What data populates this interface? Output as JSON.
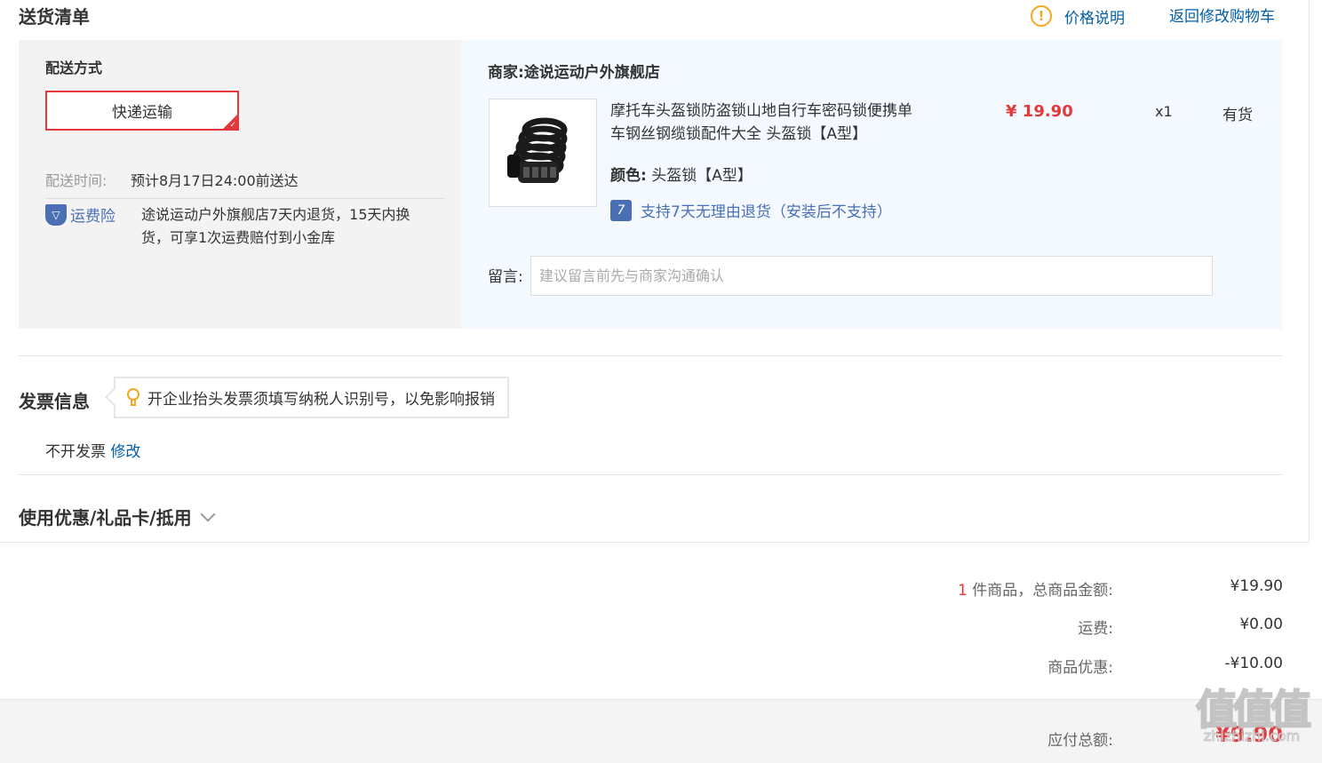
{
  "header": {
    "title": "送货清单",
    "price_note": "价格说明",
    "back_to_cart": "返回修改购物车"
  },
  "shipping": {
    "method_label": "配送方式",
    "method_selected": "快递运输",
    "time_label": "配送时间:",
    "time_value": "预计8月17日24:00前送达",
    "insurance_label": "运费险",
    "insurance_text_line1": "途说运动户外旗舰店7天内退货，15天内换",
    "insurance_text_line2": "货，可享1次运费赔付到小金库"
  },
  "store": {
    "label": "商家:",
    "name": "途说运动户外旗舰店",
    "product": {
      "title_line1": "摩托车头盔锁防盗锁山地自行车密码锁便携单",
      "title_line2": "车钢丝钢缆锁配件大全 头盔锁【A型】",
      "price": "¥ 19.90",
      "qty": "x1",
      "stock": "有货",
      "color_label": "颜色:",
      "color_value": "头盔锁【A型】",
      "return_badge": "7",
      "return_text": "支持7天无理由退货（安装后不支持）"
    },
    "message_label": "留言:",
    "message_placeholder": "建议留言前先与商家沟通确认"
  },
  "invoice": {
    "title": "发票信息",
    "tip": "开企业抬头发票须填写纳税人识别号，以免影响报销",
    "status": "不开发票",
    "modify": "修改"
  },
  "coupon": {
    "title": "使用优惠/礼品卡/抵用"
  },
  "summary": {
    "count": "1",
    "total_label": "件商品，总商品金额:",
    "total_value": "¥19.90",
    "freight_label": "运费:",
    "freight_value": "¥0.00",
    "discount_label": "商品优惠:",
    "discount_value": "-¥10.00",
    "payable_label": "应付总额:",
    "payable_value": "¥9.90"
  },
  "watermark": {
    "glyph": "值值值",
    "site": "zhizhizhi.com"
  },
  "colors": {
    "accent_red": "#e4393c",
    "link_blue": "#005ea7",
    "warning_orange": "#f5a623"
  }
}
